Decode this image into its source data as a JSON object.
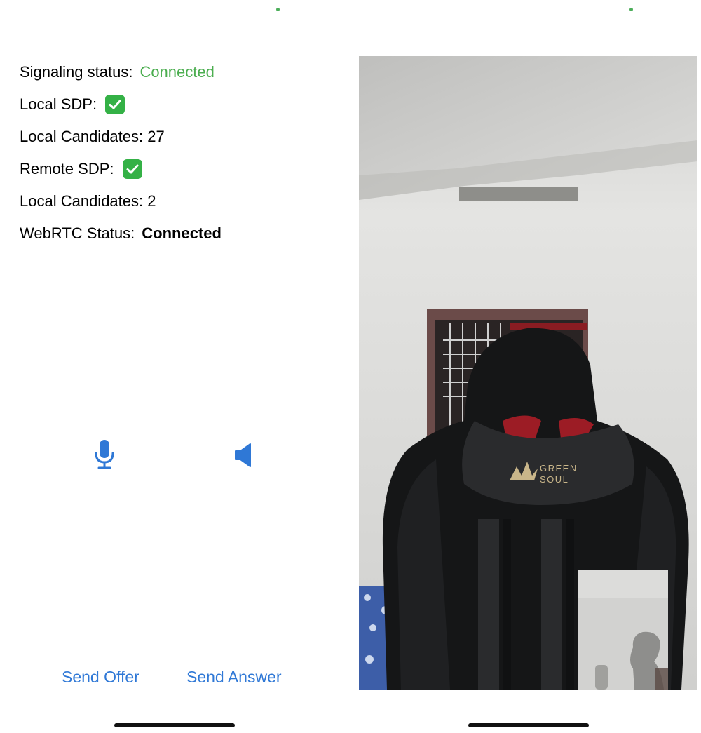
{
  "info": [
    {
      "label": "Signaling status:",
      "value": "Connected"
    },
    {
      "label": "Local SDP:"
    },
    {
      "label": "Local Candidates: 27"
    },
    {
      "label": "Remote SDP:"
    },
    {
      "label": "Local Candidates: 2"
    },
    {
      "label": "WebRTC Status:",
      "value": "Connected"
    }
  ],
  "buttons": {
    "send_offer": "Send Offer",
    "send_answer": "Send Answer"
  },
  "icons": {
    "mic": "microphone-icon",
    "speaker": "speaker-icon",
    "check": "checkmark-icon"
  },
  "video": {
    "chair_logo_line1": "GREEN",
    "chair_logo_line2": "SOUL"
  },
  "colors": {
    "accent_blue": "#2f78d6",
    "connected_green": "#4cae50",
    "check_green": "#34b146"
  }
}
